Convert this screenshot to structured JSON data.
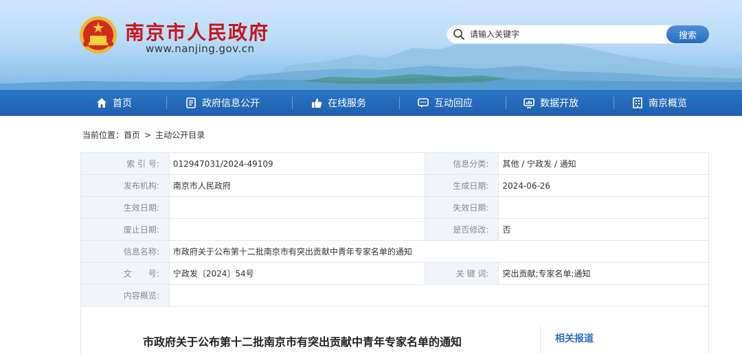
{
  "header": {
    "site_title": "南京市人民政府",
    "site_url": "www.nanjing.gov.cn",
    "emblem_icon": "national-emblem-icon",
    "search": {
      "placeholder": "请输入关键字",
      "button_label": "搜索"
    },
    "brand_color": "#c8161d"
  },
  "nav": {
    "items": [
      {
        "label": "首页",
        "icon": "home-icon"
      },
      {
        "label": "政府信息公开",
        "icon": "document-icon"
      },
      {
        "label": "在线服务",
        "icon": "thumbs-up-icon"
      },
      {
        "label": "互动回应",
        "icon": "chat-icon"
      },
      {
        "label": "数据开放",
        "icon": "data-icon"
      },
      {
        "label": "南京概览",
        "icon": "building-icon"
      }
    ],
    "color": "#1f5fae"
  },
  "breadcrumb": {
    "prefix": "当前位置：",
    "items": [
      "首页",
      "主动公开目录"
    ],
    "separator": ">"
  },
  "meta": {
    "index_label": "索 引 号:",
    "index_value": "012947031/2024-49109",
    "category_label": "信息分类:",
    "category_value": "其他 / 宁政发 / 通知",
    "publisher_label": "发布机构:",
    "publisher_value": "南京市人民政府",
    "created_label": "生成日期:",
    "created_value": "2024-06-26",
    "effective_label": "生效日期:",
    "effective_value": "",
    "expiry_label": "失效日期:",
    "expiry_value": "",
    "abolished_label": "废止日期:",
    "abolished_value": "",
    "modified_label": "是否修改:",
    "modified_value": "否",
    "name_label": "信息名称:",
    "name_value": "市政府关于公布第十二批南京市有突出贡献中青年专家名单的通知",
    "doc_label": "文　　号:",
    "doc_value": "宁政发〔2024〕54号",
    "keywords_label": "关 键 词:",
    "keywords_value": "突出贡献;专家名单;通知",
    "summary_label": "内容概览:",
    "summary_value": ""
  },
  "article": {
    "title": "市政府关于公布第十二批南京市有突出贡献中青年专家名单的通知",
    "related_title": "相关报道"
  }
}
